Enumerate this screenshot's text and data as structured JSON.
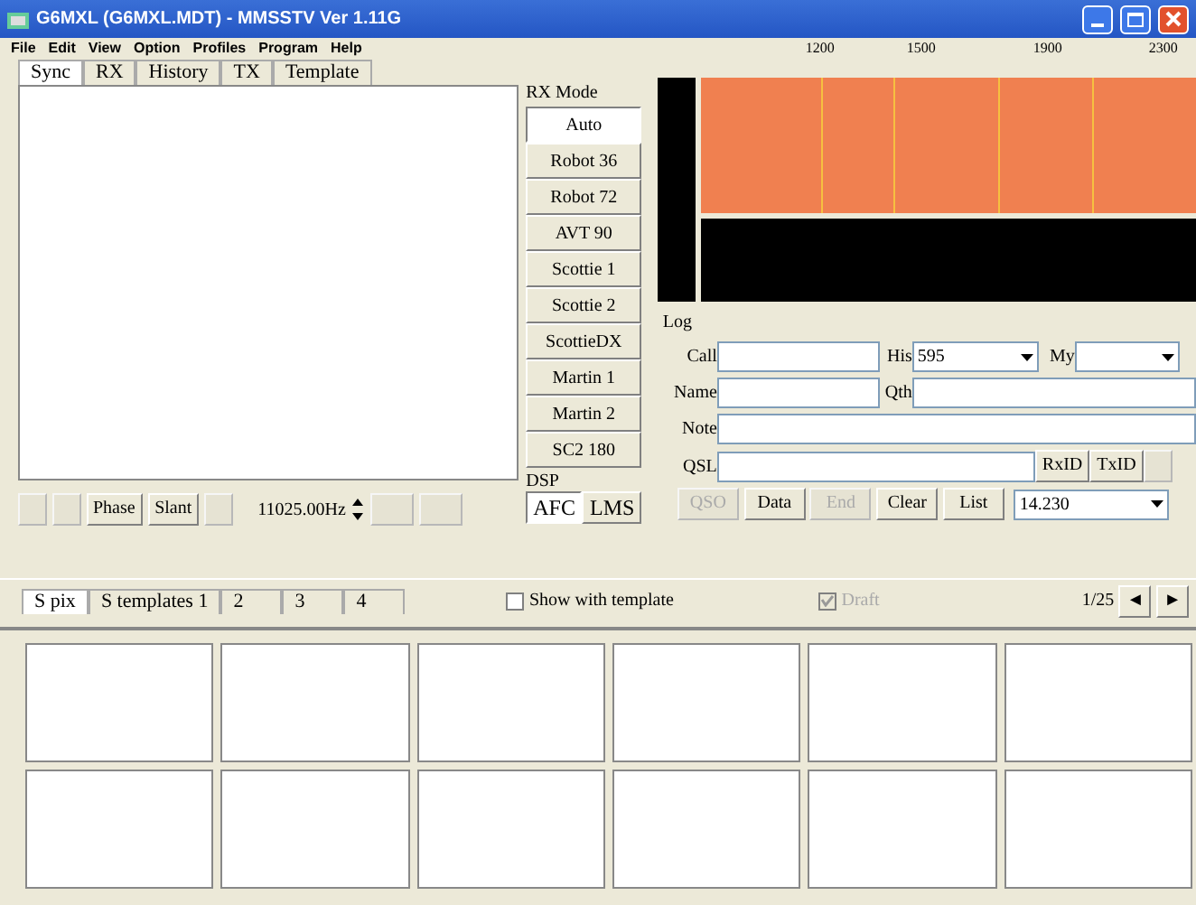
{
  "window": {
    "title": "G6MXL (G6MXL.MDT) - MMSSTV Ver 1.11G"
  },
  "menu": [
    "File",
    "Edit",
    "View",
    "Option",
    "Profiles",
    "Program",
    "Help"
  ],
  "tabs": [
    {
      "label": "Sync",
      "selected": true
    },
    {
      "label": "RX",
      "selected": false
    },
    {
      "label": "History",
      "selected": false
    },
    {
      "label": "TX",
      "selected": false
    },
    {
      "label": "Template",
      "selected": false
    }
  ],
  "rx_mode": {
    "label": "RX Mode",
    "modes": [
      {
        "label": "Auto",
        "selected": true
      },
      {
        "label": "Robot 36",
        "selected": false
      },
      {
        "label": "Robot 72",
        "selected": false
      },
      {
        "label": "AVT 90",
        "selected": false
      },
      {
        "label": "Scottie 1",
        "selected": false
      },
      {
        "label": "Scottie 2",
        "selected": false
      },
      {
        "label": "ScottieDX",
        "selected": false
      },
      {
        "label": "Martin 1",
        "selected": false
      },
      {
        "label": "Martin 2",
        "selected": false
      },
      {
        "label": "SC2 180",
        "selected": false
      }
    ]
  },
  "spectrum": {
    "ticks": [
      "1200",
      "1500",
      "1900",
      "2300"
    ]
  },
  "rx_toolbar": {
    "buttons": [
      {
        "disabled": true
      },
      {
        "disabled": true
      },
      {
        "label": "Phase",
        "disabled": false
      },
      {
        "label": "Slant",
        "disabled": false
      },
      {
        "disabled": true
      }
    ],
    "sample_rate": "11025.00Hz",
    "buttons_right": [
      {
        "disabled": true
      },
      {
        "disabled": true
      }
    ]
  },
  "dsp": {
    "label": "DSP",
    "buttons": [
      {
        "label": "AFC",
        "selected": true
      },
      {
        "label": "LMS",
        "selected": false
      }
    ]
  },
  "log": {
    "label": "Log",
    "call": {
      "label": "Call"
    },
    "his": {
      "label": "His",
      "value": "595"
    },
    "my": {
      "label": "My"
    },
    "name": {
      "label": "Name"
    },
    "qth": {
      "label": "Qth"
    },
    "note": {
      "label": "Note"
    },
    "qsl": {
      "label": "QSL"
    },
    "id_buttons": [
      {
        "label": "RxID",
        "disabled": false
      },
      {
        "label": "TxID",
        "disabled": false
      },
      {
        "disabled": true
      }
    ],
    "buttons": [
      {
        "label": "QSO",
        "disabled": true
      },
      {
        "label": "Data",
        "disabled": false
      },
      {
        "label": "End",
        "disabled": true
      },
      {
        "label": "Clear",
        "disabled": false
      },
      {
        "label": "List",
        "disabled": false
      }
    ],
    "frequency": "14.230"
  },
  "bottom_tabs": [
    {
      "label": "S pix",
      "selected": true
    },
    {
      "label": "S templates 1",
      "selected": false
    },
    {
      "label": "2",
      "selected": false
    },
    {
      "label": "3",
      "selected": false
    },
    {
      "label": "4",
      "selected": false
    }
  ],
  "show_with_template": {
    "label": "Show with template",
    "checked": false
  },
  "draft": {
    "label": "Draft",
    "checked": true,
    "disabled": true
  },
  "page": {
    "text": "1/25",
    "prev": "◄",
    "next": "►"
  },
  "thumbnails": [
    {
      "kind": "empty"
    },
    {
      "kind": "empty"
    },
    {
      "kind": "empty"
    },
    {
      "kind": "empty"
    },
    {
      "kind": "empty"
    },
    {
      "kind": "empty"
    },
    {
      "kind": "empty"
    },
    {
      "kind": "empty"
    },
    {
      "kind": "empty"
    },
    {
      "kind": "empty"
    },
    {
      "kind": "empty"
    },
    {
      "kind": "empty"
    }
  ]
}
